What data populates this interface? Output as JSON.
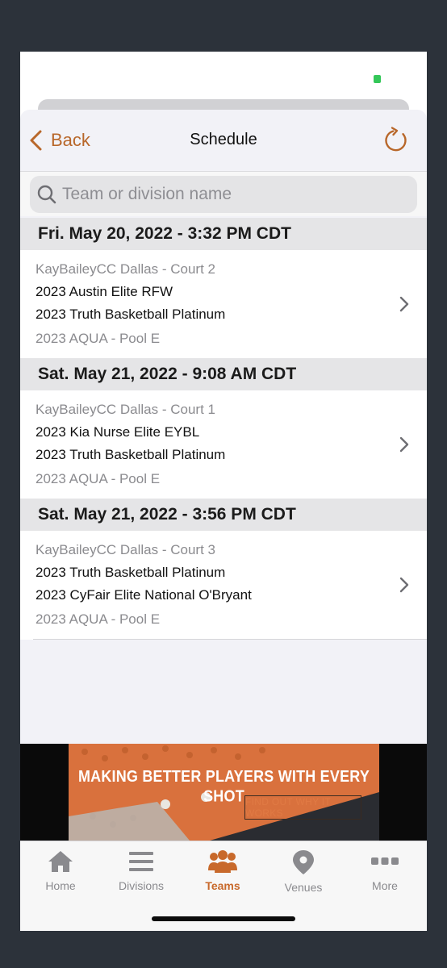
{
  "colors": {
    "accent": "#c8692b",
    "secondary_text": "#8b8b8f",
    "section_bg": "#e5e5e7"
  },
  "nav": {
    "back_label": "Back",
    "title": "Schedule"
  },
  "search": {
    "placeholder": "Team or division name",
    "value": ""
  },
  "sections": [
    {
      "header": "Fri. May 20, 2022 - 3:32 PM CDT",
      "game": {
        "venue": "KayBaileyCC Dallas - Court 2",
        "team1": "2023 Austin Elite RFW",
        "team2": "2023 Truth Basketball Platinum",
        "division": "2023 AQUA - Pool E"
      }
    },
    {
      "header": "Sat. May 21, 2022 - 9:08 AM CDT",
      "game": {
        "venue": "KayBaileyCC Dallas - Court 1",
        "team1": "2023 Kia Nurse Elite EYBL",
        "team2": "2023 Truth Basketball Platinum",
        "division": "2023 AQUA - Pool E"
      }
    },
    {
      "header": "Sat. May 21, 2022 - 3:56 PM CDT",
      "game": {
        "venue": "KayBaileyCC Dallas - Court 3",
        "team1": "2023 Truth Basketball Platinum",
        "team2": "2023 CyFair Elite National O'Bryant",
        "division": "2023 AQUA - Pool E"
      }
    }
  ],
  "ad": {
    "headline": "MAKING BETTER PLAYERS WITH EVERY SHOT",
    "cta": "FIND OUT WHY IT WORKS"
  },
  "tabs": [
    {
      "label": "Home",
      "icon": "home-icon",
      "active": false
    },
    {
      "label": "Divisions",
      "icon": "list-icon",
      "active": false
    },
    {
      "label": "Teams",
      "icon": "teams-icon",
      "active": true
    },
    {
      "label": "Venues",
      "icon": "location-pin-icon",
      "active": false
    },
    {
      "label": "More",
      "icon": "more-dots-icon",
      "active": false
    }
  ]
}
